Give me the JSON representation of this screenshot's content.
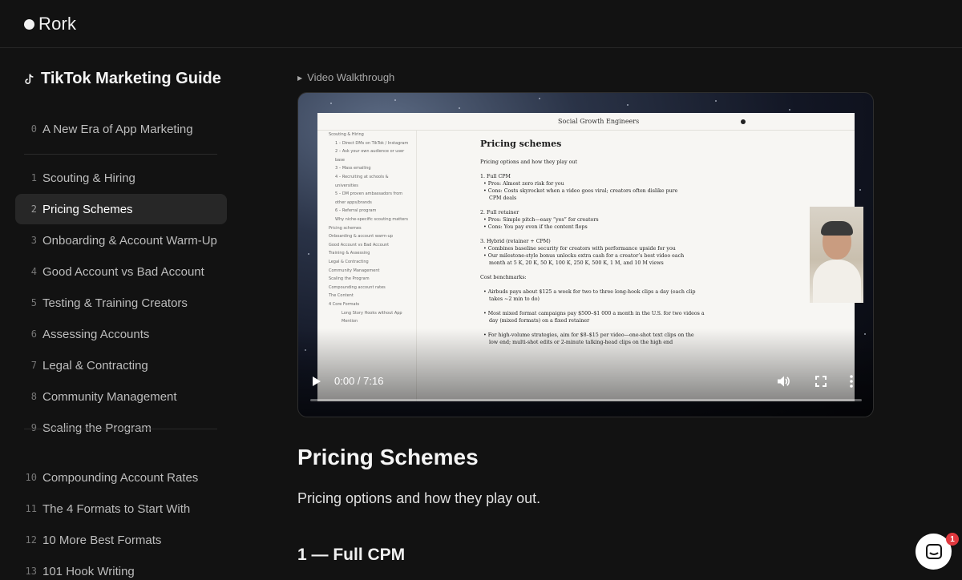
{
  "app": {
    "brand": "Rork"
  },
  "sidebar": {
    "guide_title": "TikTok Marketing Guide",
    "items": [
      {
        "num": "0",
        "label": "A New Era of App Marketing"
      },
      {
        "num": "1",
        "label": "Scouting & Hiring"
      },
      {
        "num": "2",
        "label": "Pricing Schemes",
        "active": true
      },
      {
        "num": "3",
        "label": "Onboarding & Account Warm-Up"
      },
      {
        "num": "4",
        "label": "Good Account vs Bad Account"
      },
      {
        "num": "5",
        "label": "Testing & Training Creators"
      },
      {
        "num": "6",
        "label": "Assessing Accounts"
      },
      {
        "num": "7",
        "label": "Legal & Contracting"
      },
      {
        "num": "8",
        "label": "Community Management"
      },
      {
        "num": "9",
        "label": "Scaling the Program"
      },
      {
        "num": "10",
        "label": "Compounding Account Rates"
      },
      {
        "num": "11",
        "label": "The 4 Formats to Start With"
      },
      {
        "num": "12",
        "label": "10 More Best Formats"
      },
      {
        "num": "13",
        "label": "101 Hook Writing"
      }
    ]
  },
  "video": {
    "section_label": "Video Walkthrough",
    "time": "0:00 / 7:16",
    "progress": 0.0,
    "screen": {
      "brand": "Social Growth Engineers",
      "toc": [
        "Scouting & Hiring",
        "1 – Direct DMs on TikTok / Instagram",
        "2 – Ask your own audience or user",
        "base",
        "3 – Mass emailing",
        "4 – Recruiting at schools &",
        "universities",
        "5 – DM proven ambassadors from",
        "other apps/brands",
        "6 – Referral program",
        "Why niche-specific scouting matters",
        "Pricing schemes",
        "Onboarding & account warm-up",
        "Good Account vs Bad Account",
        "Training & Assessing",
        "Legal & Contracting",
        "Community Management",
        "Scaling the Program",
        "Compounding account rates",
        "The Content",
        "4 Core Formats",
        "Long Story Hooks without App",
        "Mention"
      ],
      "heading": "Pricing schemes",
      "lines": [
        "Pricing options and how they play out",
        "",
        "1. Full CPM",
        "• Pros: Almost zero risk for you",
        "• Cons: Costs skyrocket when a video goes viral; creators often dislike pure",
        "CPM deals",
        "",
        "2. Full retainer",
        "• Pros: Simple pitch—easy “yes” for creators",
        "• Cons: You pay even if the content flops",
        "",
        "3. Hybrid (retainer + CPM)",
        "• Combines baseline security for creators with performance upside for you",
        "• Our milestone-style bonus unlocks extra cash for a creator’s best video each",
        "month at 5 K, 20 K, 50 K, 100 K, 250 K, 500 K, 1 M, and 10 M views",
        "",
        "Cost benchmarks:",
        "",
        "• Airbuds pays about $125 a week for two to three long-hook clips a day (each clip",
        "takes ~2 min to do)",
        "",
        "• Most mixed format campaigns pay $500–$1 000 a month in the U.S. for two videos a",
        "day (mixed formats) on a fixed retainer",
        "",
        "• For high-volume strategies, aim for $8–$15 per video—one-shot text clips on the",
        "low end; multi-shot edits or 2-minute talking-head clips on the high end"
      ]
    }
  },
  "content": {
    "title": "Pricing Schemes",
    "lead": "Pricing options and how they play out.",
    "subheading": "1 — Full CPM"
  },
  "chat": {
    "badge": "1"
  },
  "icons": {
    "logo": "logo-dot-icon",
    "guide": "tiktok-icon",
    "play": "play-icon",
    "volume": "volume-icon",
    "fullscreen": "fullscreen-icon",
    "more": "more-vertical-icon",
    "chat": "chat-icon"
  }
}
